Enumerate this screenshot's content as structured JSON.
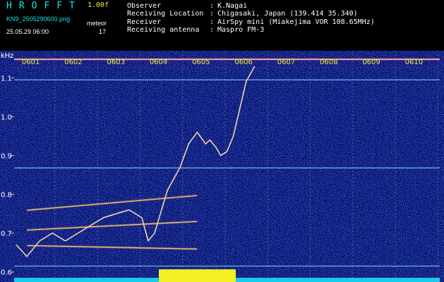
{
  "header": {
    "app_name": "HROFFT",
    "version": "1.00f",
    "filename": "KN9_2505290600.png",
    "datetime": "25.05.29 06:00",
    "sw_label": "meteor",
    "count": "17",
    "info": [
      {
        "label": "Observer",
        "value": "K.Nagai"
      },
      {
        "label": "Receiving Location",
        "value": "Chigasaki, Japan (139.414 35.340)"
      },
      {
        "label": "Receiver",
        "value": "AirSpy mini (Miakejima VOR 108.65MHz)"
      },
      {
        "label": "Receiving antenna",
        "value": "Maspro FM-3"
      }
    ],
    "separator": ":"
  },
  "colors": {
    "background": "#000000",
    "noise_dark": "#0a1a8c",
    "noise_mid": "#1c46e8",
    "grid": "#c8c8c8",
    "label": "#f0ee3a",
    "carrier": "#ffffff",
    "trace": "#ffffff"
  },
  "chart_data": {
    "type": "heatmap",
    "title": "",
    "ylabel": "kHz",
    "xlabel": "",
    "x_ticks": [
      "0601",
      "0602",
      "0603",
      "0604",
      "0605",
      "0606",
      "0607",
      "0608",
      "0609",
      "0610"
    ],
    "x_range": [
      0,
      10
    ],
    "y_ticks": [
      0.6,
      0.7,
      0.8,
      0.9,
      1.0,
      1.1
    ],
    "y_range": [
      0.585,
      1.17
    ],
    "carriers_khz": [
      1.148,
      1.095,
      0.868,
      0.615
    ],
    "parallel_traces": [
      {
        "x": [
          0.3,
          4.3
        ],
        "y": [
          0.759,
          0.797
        ]
      },
      {
        "x": [
          0.3,
          4.3
        ],
        "y": [
          0.708,
          0.73
        ]
      },
      {
        "x": [
          0.3,
          4.3
        ],
        "y": [
          0.668,
          0.659
        ]
      }
    ],
    "doppler_trace": {
      "x": [
        0.05,
        0.3,
        0.6,
        0.9,
        1.2,
        1.5,
        1.8,
        2.1,
        2.4,
        2.7,
        3.0,
        3.15,
        3.3,
        3.6,
        3.9,
        4.1,
        4.3,
        4.5,
        4.6,
        4.75,
        4.85,
        5.0,
        5.15,
        5.3,
        5.45,
        5.65
      ],
      "y": [
        0.67,
        0.64,
        0.68,
        0.7,
        0.68,
        0.7,
        0.72,
        0.74,
        0.75,
        0.76,
        0.74,
        0.68,
        0.7,
        0.81,
        0.87,
        0.93,
        0.96,
        0.93,
        0.94,
        0.92,
        0.9,
        0.91,
        0.95,
        1.02,
        1.09,
        1.13
      ]
    },
    "bottom_bar_heights": {
      "quiet": 0.3,
      "burst": 1.0,
      "burst_range": [
        3.4,
        5.2
      ]
    }
  }
}
